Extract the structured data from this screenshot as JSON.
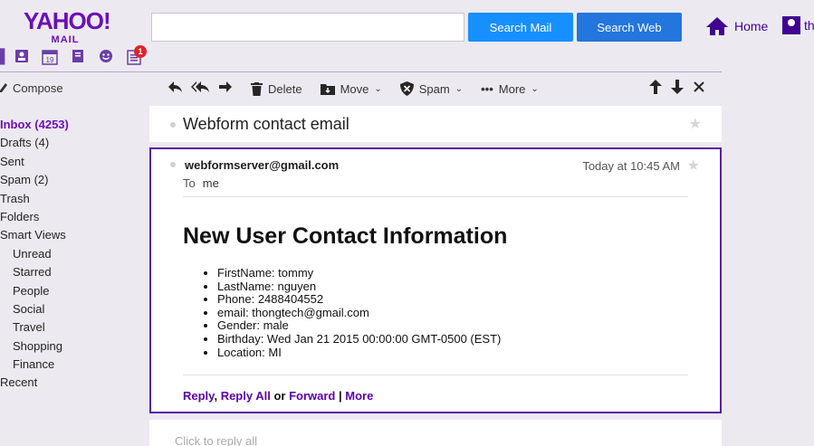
{
  "header": {
    "logo_brand": "YAHOO!",
    "logo_sub": "MAIL",
    "notification_count": "1",
    "search_placeholder": "",
    "search_mail_label": "Search Mail",
    "search_web_label": "Search Web",
    "home_label": "Home",
    "user_label": "th"
  },
  "app_icons": [
    "contacts-icon",
    "calendar-icon",
    "notepad-icon",
    "messenger-icon",
    "newsfeed-icon"
  ],
  "calendar_day": "19",
  "sidebar": {
    "compose_label": "Compose",
    "folders": [
      {
        "label": "Inbox (4253)",
        "active": true,
        "indent": false
      },
      {
        "label": "Drafts (4)",
        "active": false,
        "indent": false
      },
      {
        "label": "Sent",
        "active": false,
        "indent": false
      },
      {
        "label": "Spam (2)",
        "active": false,
        "indent": false
      },
      {
        "label": "Trash",
        "active": false,
        "indent": false
      },
      {
        "label": "Folders",
        "active": false,
        "indent": false
      },
      {
        "label": "Smart Views",
        "active": false,
        "indent": false
      },
      {
        "label": "Unread",
        "active": false,
        "indent": true
      },
      {
        "label": "Starred",
        "active": false,
        "indent": true
      },
      {
        "label": "People",
        "active": false,
        "indent": true
      },
      {
        "label": "Social",
        "active": false,
        "indent": true
      },
      {
        "label": "Travel",
        "active": false,
        "indent": true
      },
      {
        "label": "Shopping",
        "active": false,
        "indent": true
      },
      {
        "label": "Finance",
        "active": false,
        "indent": true
      },
      {
        "label": "Recent",
        "active": false,
        "indent": false
      }
    ]
  },
  "toolbar": {
    "delete_label": "Delete",
    "move_label": "Move",
    "spam_label": "Spam",
    "more_label": "More"
  },
  "message": {
    "subject": "Webform contact email",
    "sender": "webformserver@gmail.com",
    "date": "Today at 10:45 AM",
    "to_label": "To",
    "to_value": "me",
    "heading": "New User Contact Information",
    "details": [
      "FirstName: tommy",
      "LastName: nguyen",
      "Phone: 2488404552",
      "email: thongtech@gmail.com",
      "Gender: male",
      "Birthday: Wed Jan 21 2015 00:00:00 GMT-0500 (EST)",
      "Location: MI"
    ],
    "actions": {
      "reply": "Reply",
      "comma": ",",
      "reply_all": "Reply All",
      "or": "or",
      "forward": "Forward",
      "pipe": "|",
      "more": "More"
    }
  },
  "reply_box": {
    "placeholder": "Click to reply all"
  },
  "colors": {
    "accent": "#6b0fb8",
    "search_mail_button": "#188fff",
    "search_web_button": "#2475dd",
    "selected_border": "#5a1aa0",
    "badge": "#e0242d"
  }
}
